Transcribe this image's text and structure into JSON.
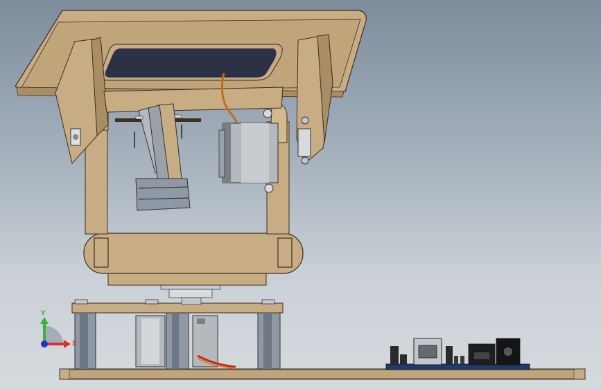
{
  "triad": {
    "y_label": "Y",
    "x_label": "X",
    "y_color": "#3bb33b",
    "x_color": "#d93030",
    "z_color": "#2233cc"
  },
  "colors": {
    "wood": "#c8ad84",
    "wood_dark": "#a98e64",
    "wood_edge": "#3a2e20",
    "window": "#2c3145",
    "servo_body": "#b4b9be",
    "board": "#1f3a6e",
    "wire": "#c46a22"
  }
}
